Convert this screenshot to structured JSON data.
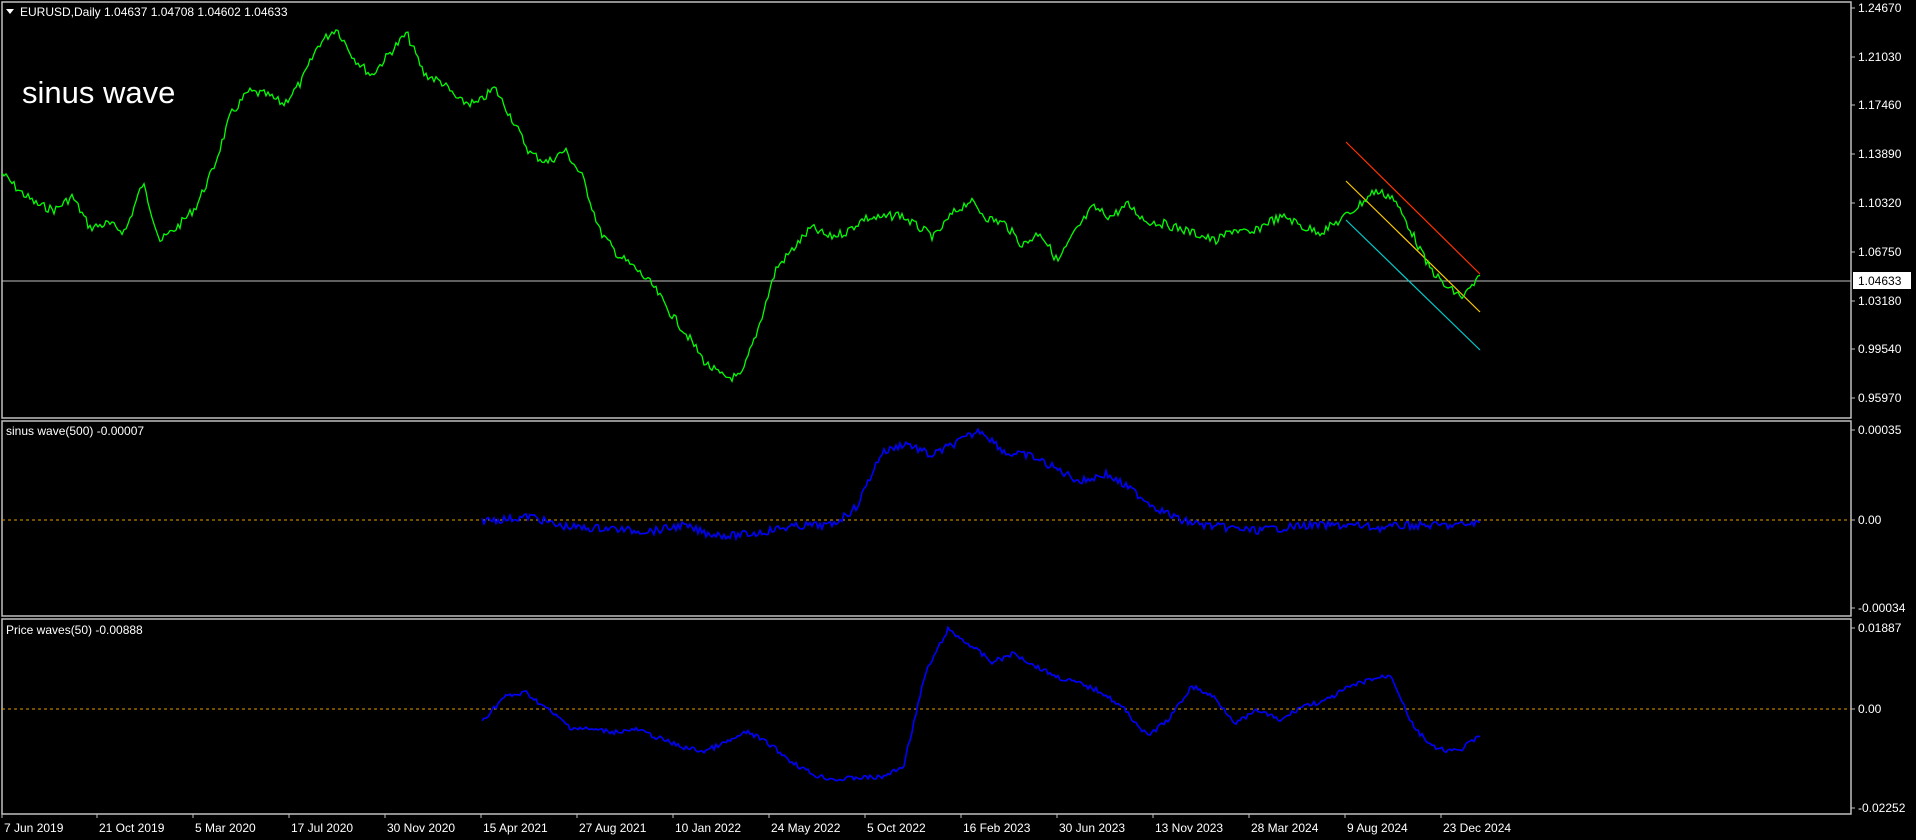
{
  "main": {
    "symbol_label": "EURUSD,Daily  1.04637 1.04708 1.04602 1.04633",
    "overlay_text": "sinus wave",
    "current_price_label": "1.04633",
    "price_ticks": [
      "1.24670",
      "1.21030",
      "1.17460",
      "1.13890",
      "1.10320",
      "1.06750",
      "1.03180",
      "0.99540",
      "0.95970"
    ]
  },
  "indicator1": {
    "label": "sinus wave(500) -0.00007",
    "ticks": [
      "0.00035",
      "0.00",
      "-0.00034"
    ]
  },
  "indicator2": {
    "label": "Price waves(50) -0.00888",
    "ticks": [
      "0.01887",
      "0.00",
      "-0.02252"
    ]
  },
  "time_axis": [
    "7 Jun 2019",
    "21 Oct 2019",
    "5 Mar 2020",
    "17 Jul 2020",
    "30 Nov 2020",
    "15 Apr 2021",
    "27 Aug 2021",
    "10 Jan 2022",
    "24 May 2022",
    "5 Oct 2022",
    "16 Feb 2023",
    "30 Jun 2023",
    "13 Nov 2023",
    "28 Mar 2024",
    "9 Aug 2024",
    "23 Dec 2024"
  ],
  "colors": {
    "background": "#000000",
    "price_line": "#00ff00",
    "indicator_line": "#0000ff",
    "zero_line": "#e0a000",
    "border": "#c0c0c0",
    "channel_top": "#ff3300",
    "channel_mid": "#ffcc00",
    "channel_bottom": "#00cccc"
  },
  "chart_data": [
    {
      "type": "line",
      "series": [
        {
          "values": [
            1.125,
            1.112,
            1.102,
            1.098,
            1.108,
            1.085,
            1.088,
            1.082,
            1.118,
            1.075,
            1.086,
            1.1,
            1.128,
            1.168,
            1.185,
            1.183,
            1.176,
            1.192,
            1.22,
            1.232,
            1.21,
            1.197,
            1.213,
            1.228,
            1.198,
            1.192,
            1.178,
            1.176,
            1.188,
            1.165,
            1.14,
            1.133,
            1.142,
            1.122,
            1.082,
            1.065,
            1.055,
            1.042,
            1.022,
            1.005,
            0.985,
            0.975,
            0.975,
            1.012,
            1.055,
            1.07,
            1.085,
            1.078,
            1.082,
            1.092,
            1.092,
            1.095,
            1.086,
            1.078,
            1.095,
            1.105,
            1.092,
            1.088,
            1.072,
            1.082,
            1.06,
            1.082,
            1.1,
            1.093,
            1.102,
            1.09,
            1.088,
            1.084,
            1.08,
            1.075,
            1.084,
            1.08,
            1.09,
            1.093,
            1.085,
            1.082,
            1.09,
            1.1,
            1.112,
            1.108,
            1.085,
            1.058,
            1.042,
            1.034,
            1.048
          ]
        }
      ]
    },
    {
      "type": "line",
      "series": [
        {
          "values": [
            0.0,
            5e-06,
            1.5e-05,
            -2e-05,
            -3e-05,
            -3e-05,
            -4e-05,
            -4e-05,
            -2e-05,
            -5e-05,
            -6e-05,
            -5e-05,
            -3e-05,
            -2e-05,
            -2e-05,
            5e-05,
            0.00026,
            0.0003,
            0.00025,
            0.0003,
            0.00035,
            0.00026,
            0.00025,
            0.0002,
            0.00015,
            0.00018,
            0.00012,
            5e-05,
            0.0,
            -2e-05,
            -3e-05,
            -4e-05,
            -3e-05,
            -2e-05,
            -2e-05,
            -2e-05,
            -3e-05,
            -2e-05,
            -2e-05,
            -2e-05,
            -1e-05
          ]
        }
      ]
    },
    {
      "type": "line",
      "series": [
        {
          "values": [
            -0.0025,
            0.003,
            0.004,
            0.0,
            -0.004,
            -0.0045,
            -0.005,
            -0.0045,
            -0.0065,
            -0.0085,
            -0.0095,
            -0.0075,
            -0.005,
            -0.008,
            -0.012,
            -0.015,
            -0.016,
            -0.0155,
            -0.0155,
            -0.013,
            0.0085,
            0.0185,
            0.015,
            0.011,
            0.013,
            0.01,
            0.0075,
            0.006,
            0.004,
            0.0,
            -0.006,
            -0.002,
            0.0055,
            0.003,
            -0.003,
            0.0,
            -0.0025,
            0.001,
            0.002,
            0.005,
            0.007,
            0.008,
            -0.004,
            -0.009,
            -0.0095,
            -0.006
          ]
        }
      ]
    }
  ]
}
